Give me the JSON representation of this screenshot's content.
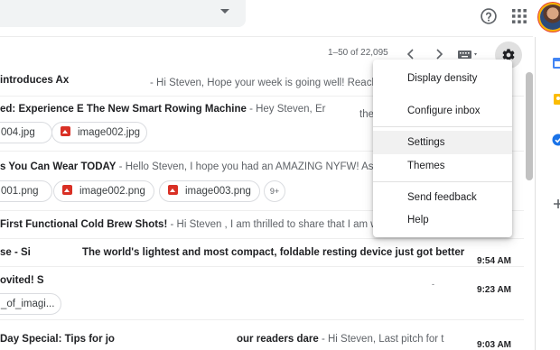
{
  "toolbar": {
    "pagination": "1–50 of 22,095",
    "icons": [
      "older-page-icon",
      "newer-page-icon",
      "keyboard-icon",
      "settings-gear-icon"
    ]
  },
  "header": {
    "icons": [
      "search-options-caret-icon",
      "help-icon",
      "apps-grid-icon",
      "account-avatar"
    ]
  },
  "emails": [
    {
      "sender": "introduces Ax",
      "subject": "",
      "snippet": "- Hi Steven, Hope your week is going well! Reachi"
    },
    {
      "sender": "",
      "subject": "ed: Experience E    The New Smart Rowing Machine",
      "snippet": "- Hey Steven, Er",
      "snippet_tail": "the",
      "attachments": [
        "004.jpg",
        "image002.jpg"
      ]
    },
    {
      "sender": "",
      "subject": "s You Can Wear TODAY",
      "snippet": "- Hello Steven, I hope you had an AMAZING NYFW! As the",
      "attachments": [
        "001.png",
        "image002.png",
        "image003.png"
      ],
      "more_attachments": "9+"
    },
    {
      "sender": "",
      "subject": "First Functional Cold Brew Shots!",
      "snippet": "- Hi Steven , I am thrilled to share that I am wor"
    },
    {
      "sender": "se - Si",
      "subject": "The world's lightest and most compact, foldable resting device just got better",
      "time": "9:54 AM"
    },
    {
      "sender": "ovited! S",
      "subject": "",
      "snippet_tail": "-",
      "time": "9:23 AM",
      "attachments": [
        "_of_imagi..."
      ]
    },
    {
      "sender": "Day Special: Tips for jo",
      "subject": "our readers dare",
      "snippet": "- Hi Steven, Last pitch for t",
      "time": "9:03 AM"
    }
  ],
  "settings_menu": {
    "items": [
      {
        "label": "Display density"
      },
      {
        "label": "Configure inbox"
      },
      {
        "label": "Settings"
      },
      {
        "label": "Themes"
      },
      {
        "label": "Send feedback"
      },
      {
        "label": "Help"
      }
    ],
    "active_index": 2
  },
  "side_panel": {
    "icons": [
      "calendar-icon",
      "keep-icon",
      "tasks-icon",
      "add-addon-icon"
    ]
  },
  "colors": {
    "accent_blue": "#1a73e8",
    "attachment_red": "#d93025",
    "keep_yellow": "#fbbc04",
    "calendar_blue": "#4285f4"
  }
}
